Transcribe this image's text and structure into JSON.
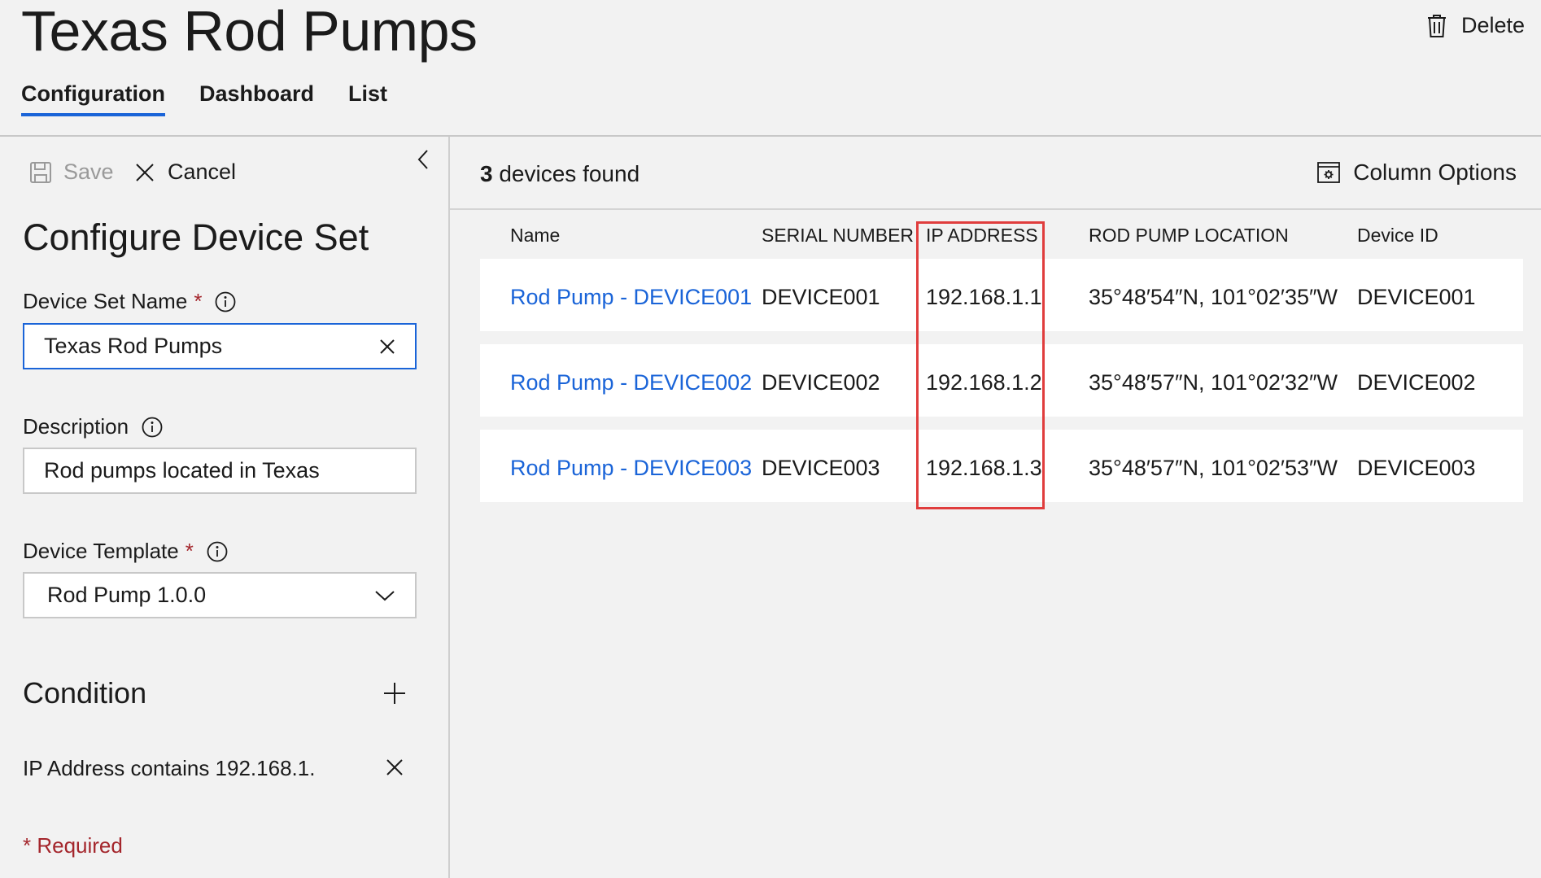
{
  "header": {
    "title": "Texas Rod Pumps",
    "delete_label": "Delete",
    "tabs": [
      {
        "label": "Configuration",
        "active": true
      },
      {
        "label": "Dashboard",
        "active": false
      },
      {
        "label": "List",
        "active": false
      }
    ]
  },
  "panel": {
    "save_label": "Save",
    "cancel_label": "Cancel",
    "heading": "Configure Device Set",
    "device_set_name": {
      "label": "Device Set Name",
      "required_mark": "*",
      "value": "Texas Rod Pumps"
    },
    "description": {
      "label": "Description",
      "value": "Rod pumps located in Texas"
    },
    "device_template": {
      "label": "Device Template",
      "required_mark": "*",
      "value": "Rod Pump 1.0.0"
    },
    "condition": {
      "heading": "Condition",
      "text": "IP Address contains 192.168.1."
    },
    "required_note": "* Required"
  },
  "results": {
    "count": "3",
    "count_suffix": "devices found",
    "column_options_label": "Column Options",
    "columns": [
      "Name",
      "SERIAL NUMBER",
      "IP ADDRESS",
      "ROD PUMP LOCATION",
      "Device ID"
    ],
    "rows": [
      {
        "name": "Rod Pump - DEVICE001",
        "serial": "DEVICE001",
        "ip": "192.168.1.1",
        "location": "35°48′54″N, 101°02′35″W",
        "device_id": "DEVICE001"
      },
      {
        "name": "Rod Pump - DEVICE002",
        "serial": "DEVICE002",
        "ip": "192.168.1.2",
        "location": "35°48′57″N, 101°02′32″W",
        "device_id": "DEVICE002"
      },
      {
        "name": "Rod Pump - DEVICE003",
        "serial": "DEVICE003",
        "ip": "192.168.1.3",
        "location": "35°48′57″N, 101°02′53″W",
        "device_id": "DEVICE003"
      }
    ]
  },
  "colors": {
    "accent": "#1a64d8",
    "required": "#a4262c",
    "highlight": "#e03d3d",
    "background": "#f2f2f2"
  },
  "icons": [
    "trash-icon",
    "chevron-left-icon",
    "save-icon",
    "close-icon",
    "info-icon",
    "chevron-down-icon",
    "plus-icon",
    "column-options-icon"
  ]
}
